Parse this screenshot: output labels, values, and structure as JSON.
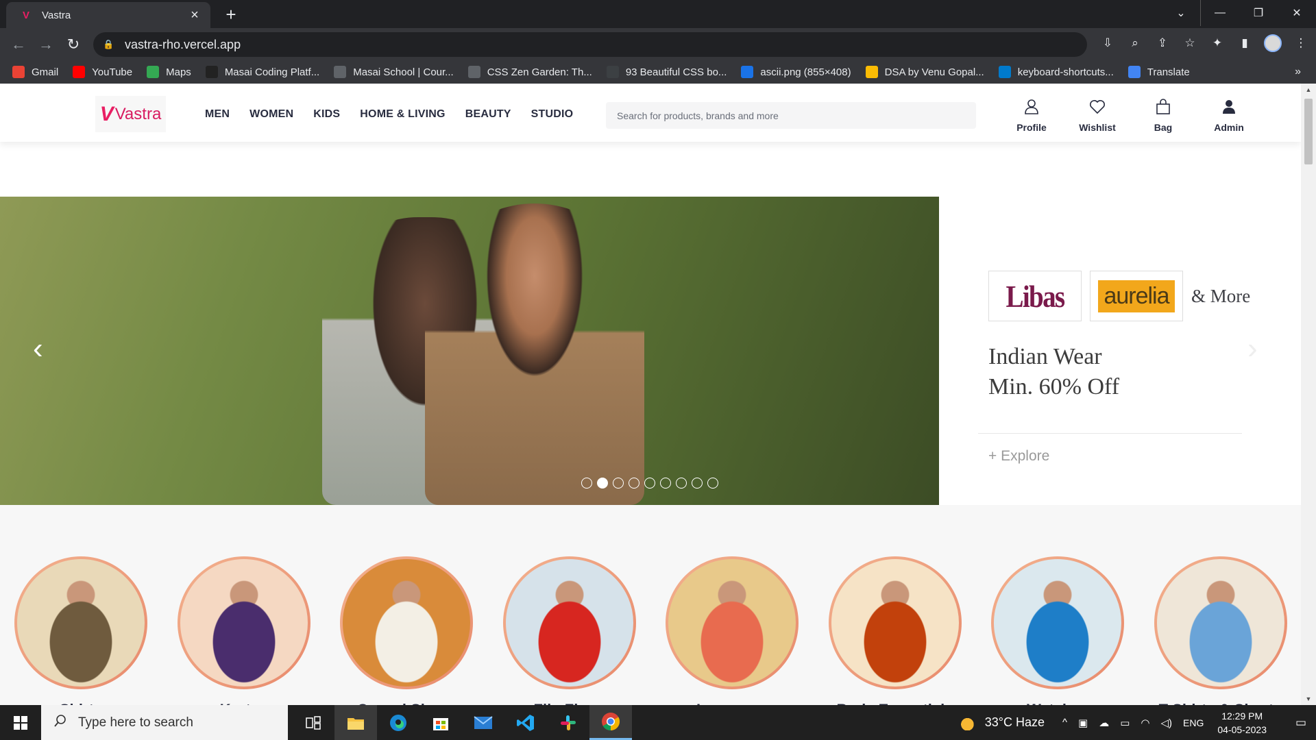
{
  "browser": {
    "tab_title": "Vastra",
    "tab_favicon": "V",
    "url": "vastra-rho.vercel.app",
    "bookmarks": [
      {
        "label": "Gmail",
        "icon": "gmail-icon",
        "color": "#ea4335"
      },
      {
        "label": "YouTube",
        "icon": "youtube-icon",
        "color": "#ff0000"
      },
      {
        "label": "Maps",
        "icon": "maps-icon",
        "color": "#34a853"
      },
      {
        "label": "Masai Coding Platf...",
        "icon": "masai-icon",
        "color": "#222222"
      },
      {
        "label": "Masai School | Cour...",
        "icon": "globe-icon",
        "color": "#5f6368"
      },
      {
        "label": "CSS Zen Garden: Th...",
        "icon": "zen-icon",
        "color": "#5f6368"
      },
      {
        "label": "93 Beautiful CSS bo...",
        "icon": "cursor-icon",
        "color": "#3c4043"
      },
      {
        "label": "ascii.png (855×408)",
        "icon": "jc-icon",
        "color": "#1a73e8"
      },
      {
        "label": "DSA by Venu Gopal...",
        "icon": "drive-icon",
        "color": "#fbbc04"
      },
      {
        "label": "keyboard-shortcuts...",
        "icon": "vscode-icon",
        "color": "#007acc"
      },
      {
        "label": "Translate",
        "icon": "translate-icon",
        "color": "#4285f4"
      }
    ]
  },
  "site": {
    "brand": "Vastra",
    "brand_mark": "V",
    "nav": [
      "MEN",
      "WOMEN",
      "KIDS",
      "HOME & LIVING",
      "BEAUTY",
      "STUDIO"
    ],
    "search_placeholder": "Search for products, brands and more",
    "actions": [
      {
        "label": "Profile",
        "icon": "profile-icon"
      },
      {
        "label": "Wishlist",
        "icon": "heart-icon"
      },
      {
        "label": "Bag",
        "icon": "bag-icon"
      },
      {
        "label": "Admin",
        "icon": "admin-icon"
      }
    ]
  },
  "hero": {
    "brand_logos": [
      "Libas",
      "aurelia"
    ],
    "brand_more": "& More",
    "offer_line1": "Indian Wear",
    "offer_line2": "Min. 60% Off",
    "explore": "+ Explore",
    "slide_count": 9,
    "active_slide": 2
  },
  "categories": [
    {
      "name": "Shirts",
      "icon": "shirt-image"
    },
    {
      "name": "Kurtas",
      "icon": "kurta-image"
    },
    {
      "name": "Casual Shoes",
      "icon": "shoes-image"
    },
    {
      "name": "Flip Flops",
      "icon": "flipflop-image"
    },
    {
      "name": "Innerwear",
      "icon": "innerwear-image"
    },
    {
      "name": "Body Essentials",
      "icon": "bodycare-image"
    },
    {
      "name": "Watches",
      "icon": "watch-image"
    },
    {
      "name": "T-Shirts & Shorts",
      "icon": "tshirt-image"
    }
  ],
  "taskbar": {
    "search_placeholder": "Type here to search",
    "weather": "33°C Haze",
    "lang": "ENG",
    "time": "12:29 PM",
    "date": "04-05-2023"
  }
}
